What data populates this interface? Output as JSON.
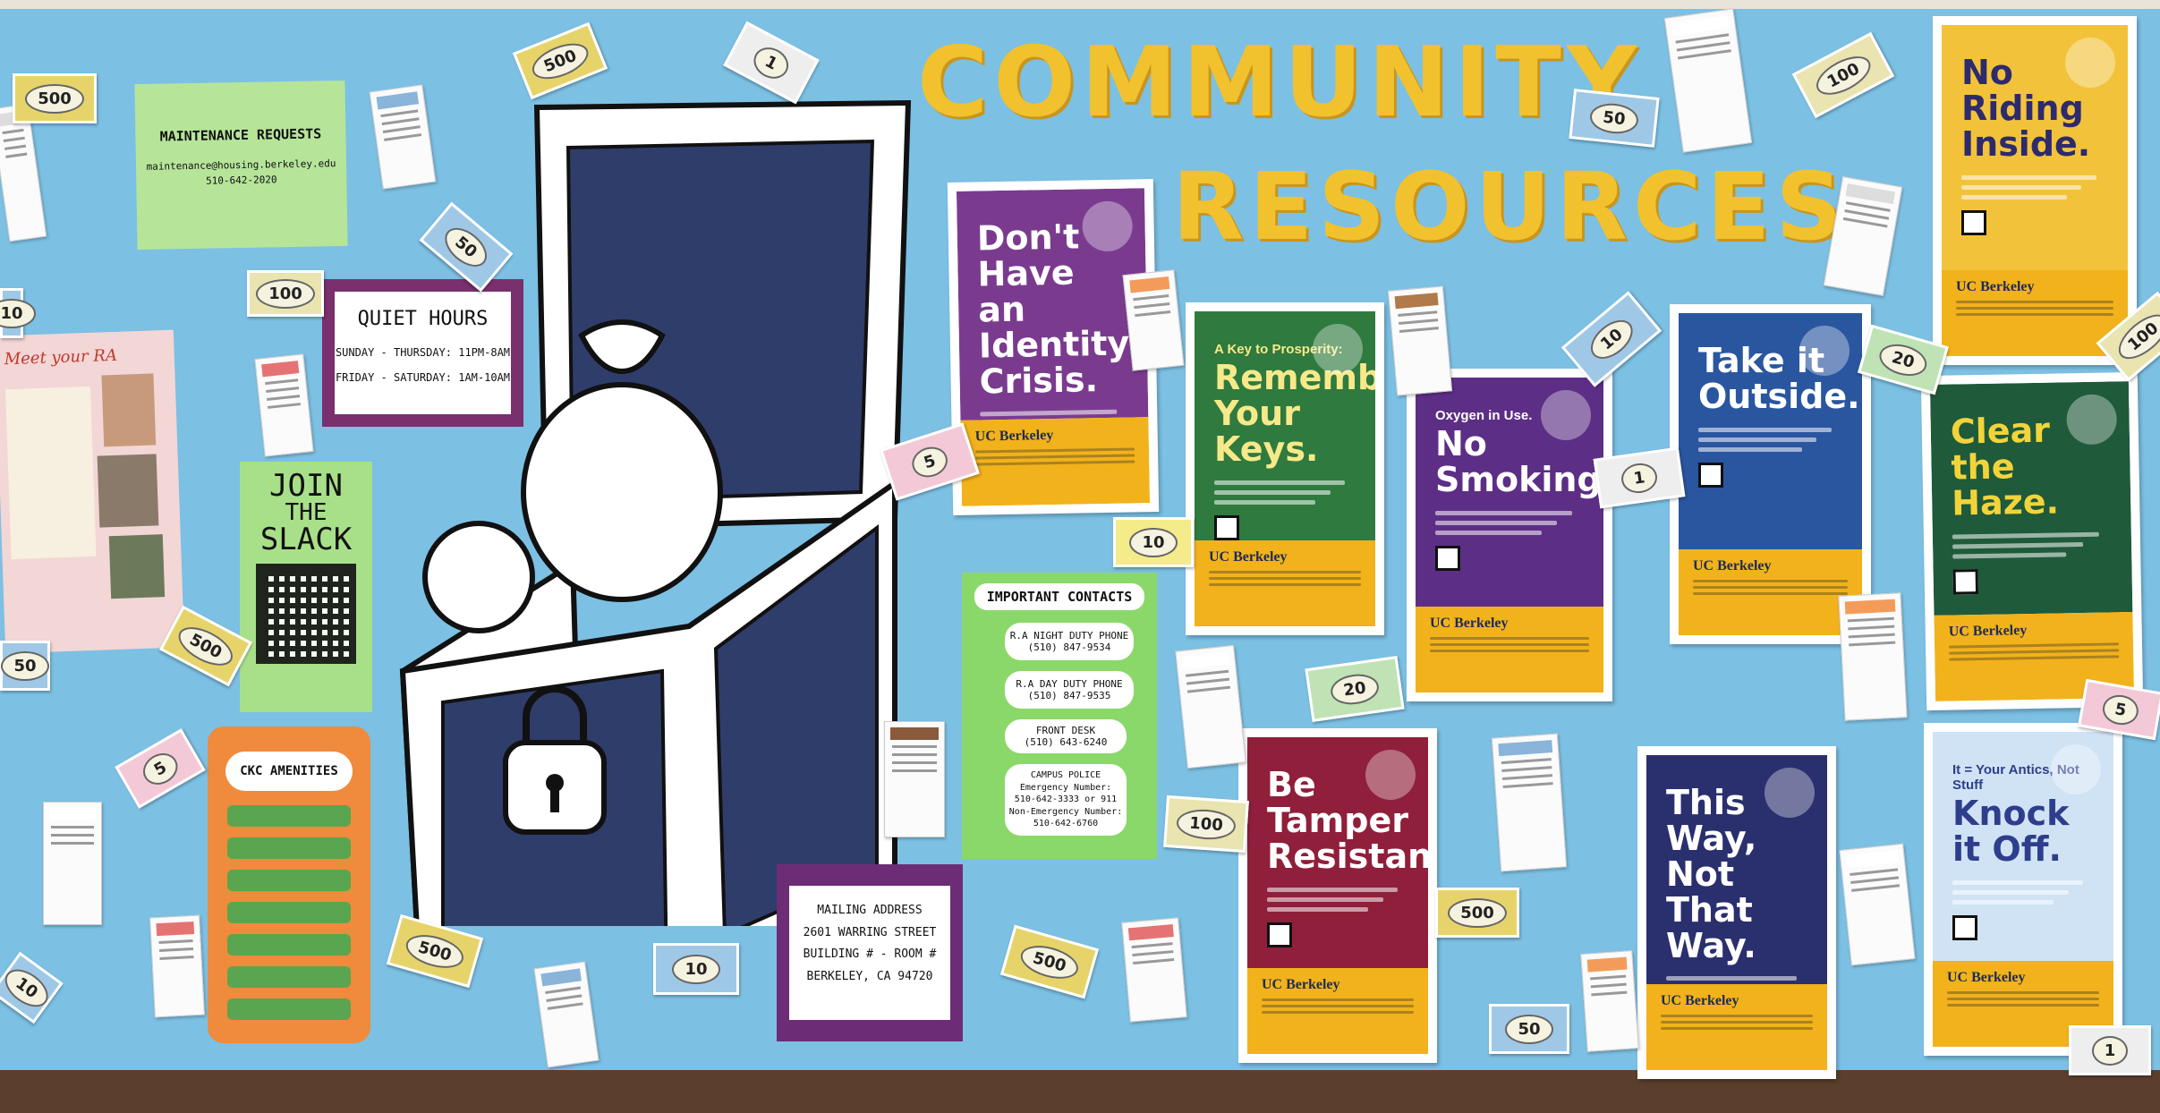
{
  "board": {
    "title_line1": "COMMUNITY",
    "title_line2": "RESOURCES"
  },
  "notes": {
    "maintenance": {
      "title": "MAINTENANCE REQUESTS",
      "line1": "maintenance@housing.berkeley.edu",
      "line2": "510-642-2020"
    },
    "quiet_hours": {
      "title": "QUIET HOURS",
      "weekday": "SUNDAY - THURSDAY: 11PM-8AM",
      "weekend": "FRIDAY - SATURDAY: 1AM-10AM"
    },
    "meet_ra": {
      "title": "Meet your RA"
    },
    "slack": {
      "line1": "JOIN",
      "line2": "THE",
      "line3": "SLACK"
    },
    "amenities": {
      "title": "CKC AMENITIES"
    },
    "contacts": {
      "title": "IMPORTANT CONTACTS",
      "night_label": "R.A NIGHT DUTY PHONE",
      "night_phone": "(510) 847-9534",
      "day_label": "R.A DAY DUTY PHONE",
      "day_phone": "(510) 847-9535",
      "front_label": "FRONT DESK",
      "front_phone": "(510) 643-6240",
      "police_label": "CAMPUS POLICE",
      "police_emergency": "Emergency Number:",
      "police_emergency_num": "510-642-3333 or 911",
      "police_non": "Non-Emergency Number:",
      "police_non_num": "510-642-6760"
    },
    "mailing": {
      "line1": "MAILING ADDRESS",
      "line2": "2601 WARRING STREET",
      "line3": "BUILDING # - ROOM #",
      "line4": "BERKELEY, CA 94720"
    }
  },
  "posters": [
    {
      "headline": "Don't Have an Identity Crisis.",
      "kicker": "",
      "brand": "UC Berkeley",
      "color": "#7a3b8f"
    },
    {
      "headline": "Remember Your Keys.",
      "kicker": "A Key to Prosperity:",
      "brand": "UC Berkeley",
      "color": "#2f7a3e"
    },
    {
      "headline": "No Smoking.",
      "kicker": "Oxygen in Use.",
      "brand": "UC Berkeley",
      "color": "#5d2e86"
    },
    {
      "headline": "Take it Outside.",
      "kicker": "",
      "brand": "UC Berkeley",
      "color": "#2a56a0"
    },
    {
      "headline": "No Riding Inside.",
      "kicker": "",
      "brand": "UC Berkeley",
      "color": "#f2c33a"
    },
    {
      "headline": "Clear the Haze.",
      "kicker": "",
      "brand": "UC Berkeley",
      "color": "#1f5a3a"
    },
    {
      "headline": "Be Tamper Resistant.",
      "kicker": "",
      "brand": "UC Berkeley",
      "color": "#8f1f3a"
    },
    {
      "headline": "This Way, Not That Way.",
      "kicker": "",
      "brand": "UC Berkeley",
      "color": "#2a2f6e"
    },
    {
      "headline": "Knock it Off.",
      "kicker": "It = Your Antics, Not Stuff",
      "brand": "UC Berkeley",
      "color": "#cfe3f5"
    }
  ],
  "bills": [
    {
      "label": "500",
      "color": "#e6d46a"
    },
    {
      "label": "500",
      "color": "#e6d46a"
    },
    {
      "label": "1",
      "color": "#eeeeee"
    },
    {
      "label": "100",
      "color": "#e9e4b0"
    },
    {
      "label": "50",
      "color": "#9ec8e6"
    },
    {
      "label": "100",
      "color": "#e9e4b0"
    },
    {
      "label": "20",
      "color": "#bfe3b5"
    },
    {
      "label": "100",
      "color": "#e9e4b0"
    },
    {
      "label": "5",
      "color": "#f3c9d8"
    },
    {
      "label": "10",
      "color": "#f4eb8a"
    },
    {
      "label": "10",
      "color": "#9ec8e6"
    },
    {
      "label": "1",
      "color": "#eeeeee"
    },
    {
      "label": "50",
      "color": "#9ec8e6"
    },
    {
      "label": "500",
      "color": "#e6d46a"
    },
    {
      "label": "20",
      "color": "#bfe3b5"
    },
    {
      "label": "100",
      "color": "#e9e4b0"
    },
    {
      "label": "500",
      "color": "#e6d46a"
    },
    {
      "label": "500",
      "color": "#e6d46a"
    },
    {
      "label": "10",
      "color": "#9ec8e6"
    },
    {
      "label": "500",
      "color": "#e6d46a"
    },
    {
      "label": "50",
      "color": "#9ec8e6"
    },
    {
      "label": "5",
      "color": "#f3c9d8"
    },
    {
      "label": "1",
      "color": "#eeeeee"
    },
    {
      "label": "5",
      "color": "#f3c9d8"
    },
    {
      "label": "50",
      "color": "#9ec8e6"
    },
    {
      "label": "10",
      "color": "#9ec8e6"
    },
    {
      "label": "10",
      "color": "#9ec8e6"
    },
    {
      "label": "500",
      "color": "#e6d46a"
    }
  ],
  "colors": {
    "board": "#7cc0e4",
    "title": "#f2c12e",
    "chest": "#2f3d6b",
    "band": "#f2b21b"
  }
}
